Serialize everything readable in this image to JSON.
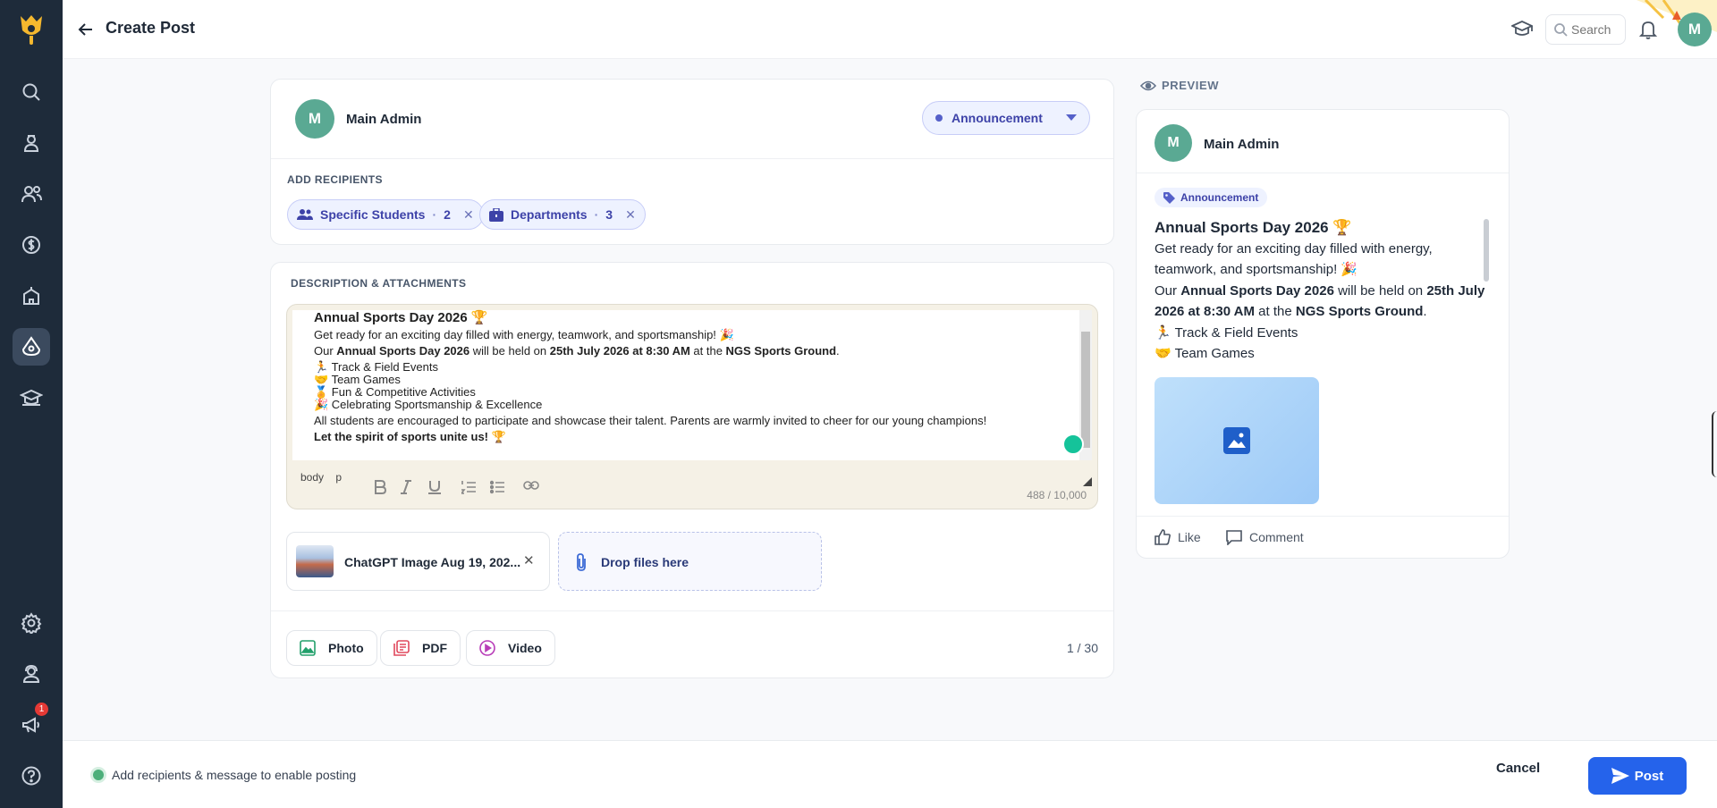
{
  "header": {
    "title": "Create Post",
    "search_placeholder": "Search",
    "user_initial": "M"
  },
  "sidebar": {
    "notification_badge": "1"
  },
  "composer": {
    "author_initial": "M",
    "author_name": "Main Admin",
    "post_type": "Announcement",
    "recipients_label": "ADD RECIPIENTS",
    "recipients": [
      {
        "label": "Specific Students",
        "count": "2"
      },
      {
        "label": "Departments",
        "count": "3"
      }
    ]
  },
  "description": {
    "label": "DESCRIPTION & ATTACHMENTS",
    "heading": "Annual Sports Day 2026 🏆",
    "intro": "Get ready for an exciting day filled with energy, teamwork, and sportsmanship! 🎉",
    "detail_pre": "Our ",
    "detail_event": "Annual Sports Day 2026",
    "detail_mid": " will be held on ",
    "detail_date": "25th July 2026 at 8:30 AM",
    "detail_at": " at the ",
    "detail_venue": "NGS Sports Ground",
    "detail_end": ".",
    "list": [
      "🏃 Track & Field Events",
      "🤝 Team Games",
      "🏅 Fun & Competitive Activities",
      "🎉 Celebrating Sportsmanship & Excellence"
    ],
    "closing": "All students are encouraged to participate and showcase their talent. Parents are warmly invited to cheer for our young champions!",
    "signoff": "Let the spirit of sports unite us! 🏆",
    "path_body": "body",
    "path_p": "p",
    "char_count": "488 / 10,000"
  },
  "attachments": {
    "file_name": "ChatGPT Image Aug 19, 202...",
    "drop_label": "Drop files here",
    "photo_label": "Photo",
    "pdf_label": "PDF",
    "video_label": "Video",
    "count": "1 / 30"
  },
  "preview": {
    "label": "PREVIEW",
    "author_initial": "M",
    "author_name": "Main Admin",
    "tag": "Announcement",
    "heading": "Annual Sports Day 2026 🏆",
    "intro": "Get ready for an exciting day filled with energy, teamwork, and sportsmanship! 🎉",
    "detail_pre": "Our ",
    "detail_event": "Annual Sports Day 2026",
    "detail_mid": " will be held on ",
    "detail_date": "25th July 2026 at 8:30 AM",
    "detail_at": " at the ",
    "detail_venue": "NGS Sports Ground",
    "detail_end": ".",
    "list": [
      "🏃 Track & Field Events",
      "🤝 Team Games"
    ],
    "like_label": "Like",
    "comment_label": "Comment"
  },
  "footer": {
    "status": "Add recipients & message to enable posting",
    "cancel_label": "Cancel",
    "post_label": "Post"
  },
  "colors": {
    "sidebar": "#1e2b3a",
    "accent": "#2563eb",
    "avatar": "#5aa993",
    "chip_text": "#3d42a8"
  }
}
